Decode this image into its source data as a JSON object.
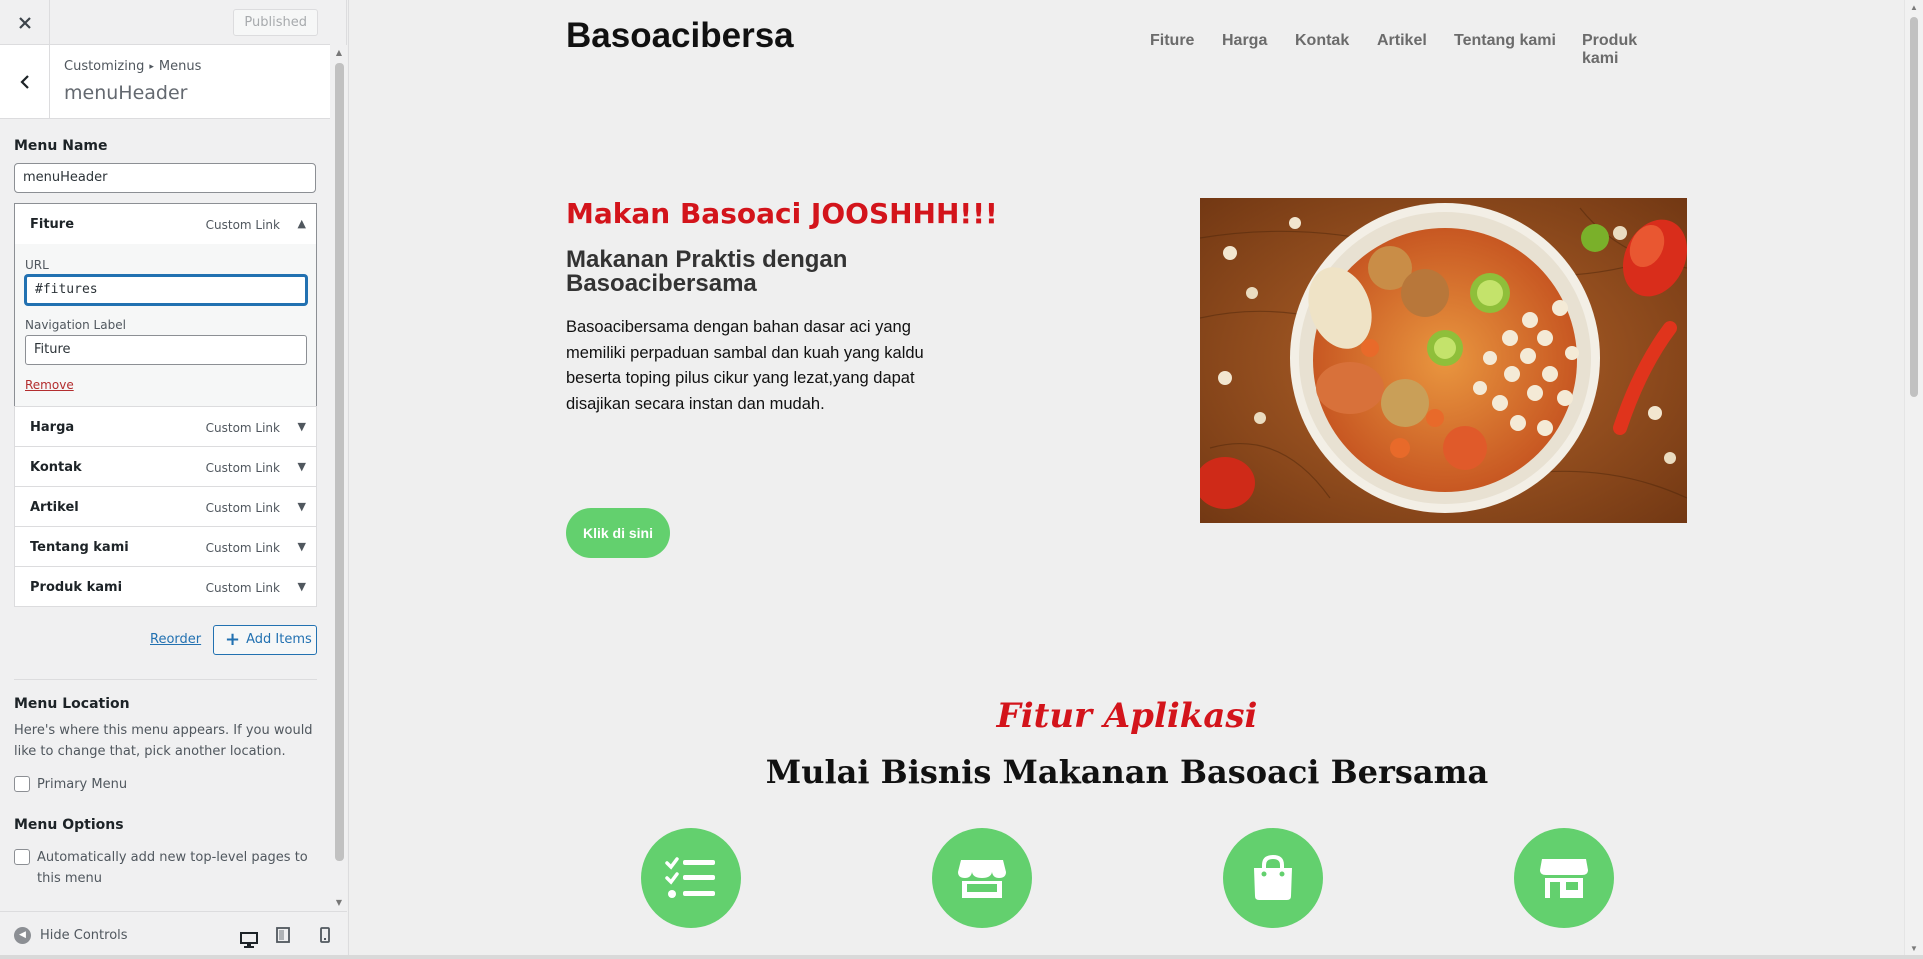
{
  "customizer": {
    "close_icon": "close-icon",
    "published_label": "Published",
    "breadcrumb": {
      "root": "Customizing",
      "separator": "▸",
      "section": "Menus"
    },
    "panel_title": "menuHeader",
    "menu_name_label": "Menu Name",
    "menu_name_value": "menuHeader",
    "menu_items": [
      {
        "title": "Fiture",
        "type": "Custom Link",
        "expanded": true,
        "url_label": "URL",
        "url_value": "#fitures",
        "nav_label_label": "Navigation Label",
        "nav_label_value": "Fiture",
        "remove_label": "Remove"
      },
      {
        "title": "Harga",
        "type": "Custom Link",
        "expanded": false
      },
      {
        "title": "Kontak",
        "type": "Custom Link",
        "expanded": false
      },
      {
        "title": "Artikel",
        "type": "Custom Link",
        "expanded": false
      },
      {
        "title": "Tentang kami",
        "type": "Custom Link",
        "expanded": false
      },
      {
        "title": "Produk kami",
        "type": "Custom Link",
        "expanded": false
      }
    ],
    "reorder_label": "Reorder",
    "add_items_label": "Add Items",
    "menu_location_heading": "Menu Location",
    "menu_location_desc": "Here's where this menu appears. If you would like to change that, pick another location.",
    "primary_menu_label": "Primary Menu",
    "primary_menu_checked": false,
    "menu_options_heading": "Menu Options",
    "auto_add_label": "Automatically add new top-level pages to this menu",
    "auto_add_checked": false,
    "hide_controls_label": "Hide Controls",
    "preview_device": "desktop"
  },
  "preview": {
    "site_title": "Basoacibersa",
    "nav": [
      "Fiture",
      "Harga",
      "Kontak",
      "Artikel",
      "Tentang kami",
      "Produk kami"
    ],
    "hero": {
      "kicker": "Makan Basoaci JOOSHHH!!!",
      "title": "Makanan Praktis dengan Basoacibersama",
      "body": "Basoacibersama dengan bahan dasar aci yang memiliki perpaduan sambal dan kuah yang kaldu beserta toping pilus cikur yang lezat,yang dapat disajikan secara instan dan mudah.",
      "cta_label": "Klik di sini",
      "image": "bowl-of-baso-aci-photo"
    },
    "features": {
      "kicker": "Fitur Aplikasi",
      "title": "Mulai Bisnis Makanan Basoaci Bersama",
      "icons": [
        "checklist-icon",
        "storefront-icon",
        "shopping-bag-icon",
        "shop-icon"
      ]
    },
    "colors": {
      "accent_red": "#d3141b",
      "accent_green": "#63d06e",
      "wp_blue": "#2271b1"
    }
  }
}
